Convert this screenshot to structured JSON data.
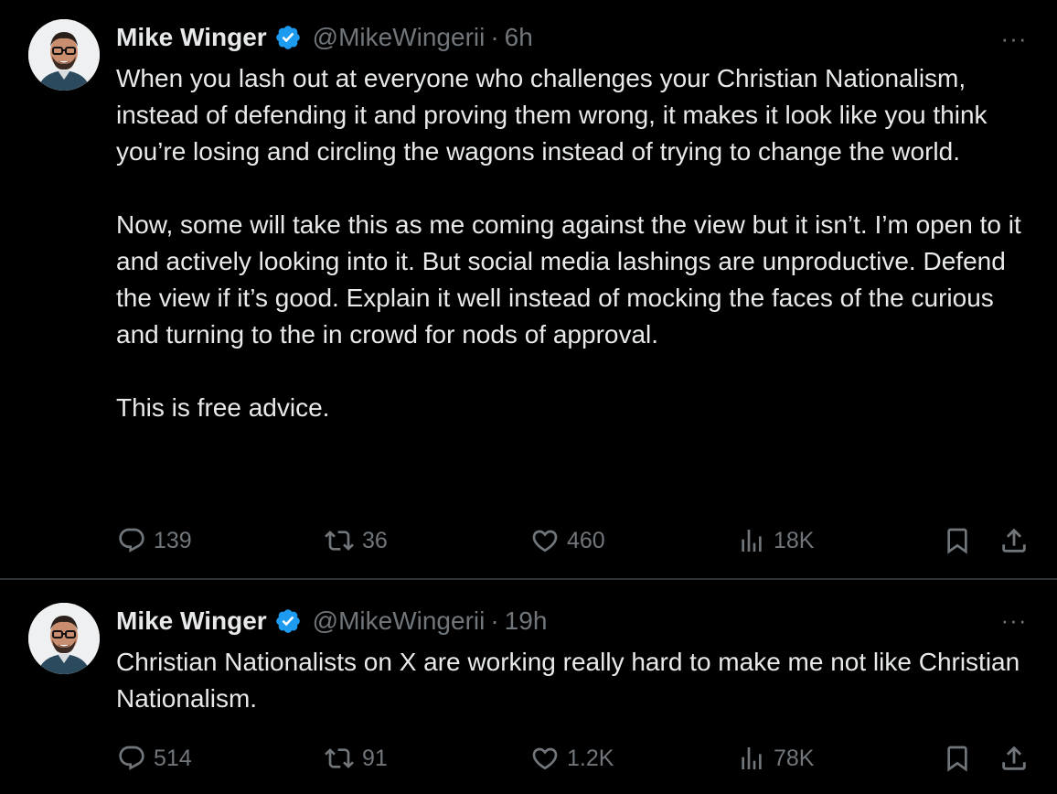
{
  "tweets": [
    {
      "author": {
        "name": "Mike Winger",
        "handle": "@MikeWingerii",
        "separator": "·",
        "time": "6h",
        "verified": true
      },
      "paragraphs": [
        "When you lash out at everyone who challenges your Christian Nationalism, instead of defending it and proving them wrong, it makes it look like you think you’re losing and circling the wagons instead of trying to change the world.",
        "Now, some will take this as me coming against the view but it isn’t. I’m open to it and actively looking into it. But social media lashings are unproductive. Defend the view if it’s good. Explain it well instead of mocking the faces of the curious and turning to the in crowd for nods of approval.",
        "This is free advice."
      ],
      "stats": {
        "replies": "139",
        "reposts": "36",
        "likes": "460",
        "views": "18K"
      },
      "more_label": "···"
    },
    {
      "author": {
        "name": "Mike Winger",
        "handle": "@MikeWingerii",
        "separator": "·",
        "time": "19h",
        "verified": true
      },
      "paragraphs": [
        "Christian Nationalists on X are working really hard to make me not like Christian Nationalism."
      ],
      "stats": {
        "replies": "514",
        "reposts": "91",
        "likes": "1.2K",
        "views": "78K"
      },
      "more_label": "···"
    }
  ],
  "colors": {
    "background": "#000000",
    "text": "#e7e9ea",
    "secondary": "#71767b",
    "verified": "#1d9bf0",
    "divider": "#2f3336"
  },
  "icons": {
    "reply": "reply-icon",
    "repost": "repost-icon",
    "like": "like-icon",
    "views": "views-icon",
    "bookmark": "bookmark-icon",
    "share": "share-icon",
    "more": "more-icon",
    "verified": "verified-badge-icon"
  }
}
